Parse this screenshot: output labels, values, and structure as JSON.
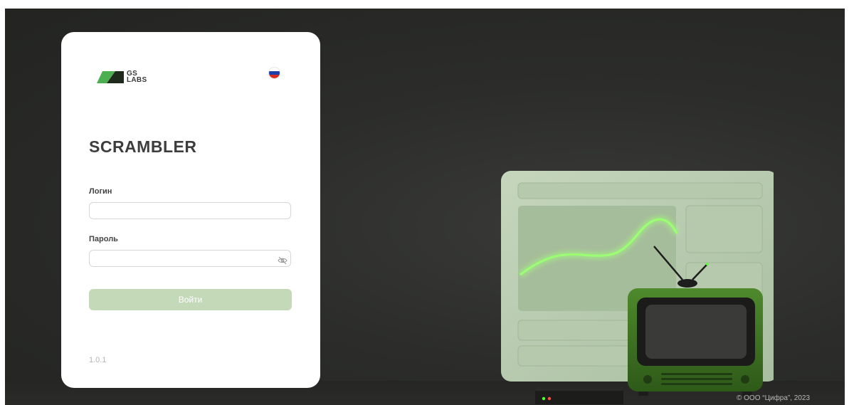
{
  "brand": {
    "logo_text_line1": "GS",
    "logo_text_line2": "LABS",
    "accent_color": "#4caf50",
    "button_color": "#c4d9b8"
  },
  "language": {
    "icon": "russia-flag-icon",
    "current": "ru"
  },
  "login_form": {
    "title": "SCRAMBLER",
    "login_label": "Логин",
    "login_value": "",
    "password_label": "Пароль",
    "password_value": "",
    "password_toggle_icon": "eye-slash-icon",
    "submit_label": "Войти"
  },
  "footer": {
    "version": "1.0.1",
    "copyright": "© ООО “Цифра”, 2023"
  }
}
